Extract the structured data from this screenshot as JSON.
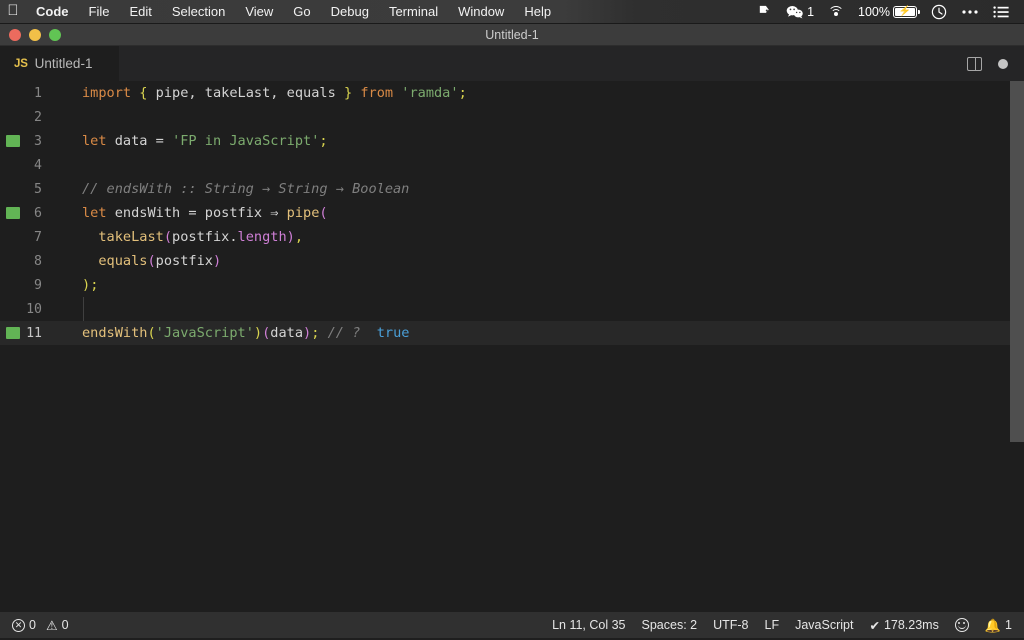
{
  "menubar": {
    "apple_icon": "apple-logo",
    "items": [
      {
        "label": "Code",
        "bold": true
      },
      {
        "label": "File",
        "bold": false
      },
      {
        "label": "Edit",
        "bold": false
      },
      {
        "label": "Selection",
        "bold": false
      },
      {
        "label": "View",
        "bold": false
      },
      {
        "label": "Go",
        "bold": false
      },
      {
        "label": "Debug",
        "bold": false
      },
      {
        "label": "Terminal",
        "bold": false
      },
      {
        "label": "Window",
        "bold": false
      },
      {
        "label": "Help",
        "bold": false
      }
    ],
    "status": {
      "dropbox_icon": "dropbox-icon",
      "wechat_icon": "wechat-icon",
      "wechat_badge": "1",
      "wifi_icon": "wifi-icon",
      "battery_percent": "100%",
      "battery_icon": "battery-charging-icon",
      "dnd_icon": "do-not-disturb-clock-icon",
      "more_icon": "ellipsis-icon",
      "controlcenter_icon": "list-icon"
    }
  },
  "window": {
    "title": "Untitled-1",
    "traffic_lights": {
      "close": "close-button",
      "minimize": "minimize-button",
      "maximize": "maximize-button"
    }
  },
  "tabbar": {
    "tab": {
      "badge": "JS",
      "label": "Untitled-1"
    },
    "split_editor_icon": "split-editor-icon",
    "unsaved_indicator": "unsaved-dot"
  },
  "editor": {
    "lines": [
      {
        "no": "1",
        "modified": false,
        "active": false,
        "tokens": [
          {
            "t": "import",
            "c": "t-kw"
          },
          {
            "t": " ",
            "c": "t-punct"
          },
          {
            "t": "{",
            "c": "t-brace"
          },
          {
            "t": " ",
            "c": "t-punct"
          },
          {
            "t": "pipe",
            "c": "t-ident"
          },
          {
            "t": ", ",
            "c": "t-punct"
          },
          {
            "t": "takeLast",
            "c": "t-ident"
          },
          {
            "t": ", ",
            "c": "t-punct"
          },
          {
            "t": "equals",
            "c": "t-ident"
          },
          {
            "t": " ",
            "c": "t-punct"
          },
          {
            "t": "}",
            "c": "t-brace"
          },
          {
            "t": " ",
            "c": "t-punct"
          },
          {
            "t": "from",
            "c": "t-kw"
          },
          {
            "t": " ",
            "c": "t-punct"
          },
          {
            "t": "'ramda'",
            "c": "t-string"
          },
          {
            "t": ";",
            "c": "t-semi"
          }
        ]
      },
      {
        "no": "2",
        "modified": false,
        "active": false,
        "tokens": []
      },
      {
        "no": "3",
        "modified": true,
        "active": false,
        "tokens": [
          {
            "t": "let",
            "c": "t-kw"
          },
          {
            "t": " ",
            "c": "t-punct"
          },
          {
            "t": "data",
            "c": "t-ident"
          },
          {
            "t": " = ",
            "c": "t-punct"
          },
          {
            "t": "'FP in JavaScript'",
            "c": "t-string"
          },
          {
            "t": ";",
            "c": "t-semi"
          }
        ]
      },
      {
        "no": "4",
        "modified": false,
        "active": false,
        "tokens": []
      },
      {
        "no": "5",
        "modified": false,
        "active": false,
        "tokens": [
          {
            "t": "// endsWith :: String → String → Boolean",
            "c": "t-comment"
          }
        ]
      },
      {
        "no": "6",
        "modified": true,
        "active": false,
        "tokens": [
          {
            "t": "let",
            "c": "t-kw"
          },
          {
            "t": " ",
            "c": "t-punct"
          },
          {
            "t": "endsWith",
            "c": "t-ident"
          },
          {
            "t": " = ",
            "c": "t-punct"
          },
          {
            "t": "postfix",
            "c": "t-ident"
          },
          {
            "t": " ⇒ ",
            "c": "t-punct"
          },
          {
            "t": "pipe",
            "c": "t-func"
          },
          {
            "t": "(",
            "c": "t-paren"
          }
        ]
      },
      {
        "no": "7",
        "modified": false,
        "active": false,
        "tokens": [
          {
            "t": "  ",
            "c": "t-punct"
          },
          {
            "t": "takeLast",
            "c": "t-func"
          },
          {
            "t": "(",
            "c": "t-paren"
          },
          {
            "t": "postfix",
            "c": "t-ident"
          },
          {
            "t": ".",
            "c": "t-punct"
          },
          {
            "t": "length",
            "c": "t-prop"
          },
          {
            "t": ")",
            "c": "t-paren"
          },
          {
            "t": ",",
            "c": "t-semi"
          }
        ]
      },
      {
        "no": "8",
        "modified": false,
        "active": false,
        "tokens": [
          {
            "t": "  ",
            "c": "t-punct"
          },
          {
            "t": "equals",
            "c": "t-func"
          },
          {
            "t": "(",
            "c": "t-paren"
          },
          {
            "t": "postfix",
            "c": "t-ident"
          },
          {
            "t": ")",
            "c": "t-paren"
          }
        ]
      },
      {
        "no": "9",
        "modified": false,
        "active": false,
        "tokens": [
          {
            "t": ")",
            "c": "t-paren2"
          },
          {
            "t": ";",
            "c": "t-semi"
          }
        ]
      },
      {
        "no": "10",
        "modified": false,
        "active": false,
        "tokens": []
      },
      {
        "no": "11",
        "modified": true,
        "active": true,
        "tokens": [
          {
            "t": "endsWith",
            "c": "t-func"
          },
          {
            "t": "(",
            "c": "t-paren2"
          },
          {
            "t": "'JavaScript'",
            "c": "t-string"
          },
          {
            "t": ")",
            "c": "t-paren2"
          },
          {
            "t": "(",
            "c": "t-paren"
          },
          {
            "t": "data",
            "c": "t-ident"
          },
          {
            "t": ")",
            "c": "t-paren"
          },
          {
            "t": ";",
            "c": "t-semi"
          },
          {
            "t": " ",
            "c": "t-punct"
          },
          {
            "t": "// ?",
            "c": "t-comment"
          },
          {
            "t": "  ",
            "c": "t-punct"
          },
          {
            "t": "true",
            "c": "t-bool"
          }
        ]
      }
    ]
  },
  "statusbar": {
    "errors_icon": "error-circle-icon",
    "errors_count": "0",
    "warnings_icon": "warning-triangle-icon",
    "warnings_count": "0",
    "cursor_position": "Ln 11, Col 35",
    "indentation": "Spaces: 2",
    "encoding": "UTF-8",
    "eol": "LF",
    "language": "JavaScript",
    "runtime_icon": "check-icon",
    "runtime": "178.23ms",
    "feedback_icon": "smiley-icon",
    "bell_icon": "bell-icon",
    "bell_count": "1"
  }
}
